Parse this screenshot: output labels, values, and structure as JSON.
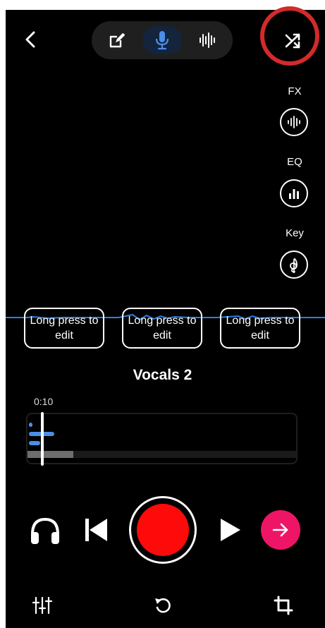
{
  "header": {
    "back_icon": "chevron-left-icon",
    "modes": [
      {
        "icon": "edit-icon",
        "active": false
      },
      {
        "icon": "microphone-icon",
        "active": true
      },
      {
        "icon": "waveform-icon",
        "active": false
      }
    ],
    "shuffle_icon": "shuffle-icon"
  },
  "side_controls": [
    {
      "label": "FX",
      "icon": "audio-wave-icon"
    },
    {
      "label": "EQ",
      "icon": "bar-chart-icon"
    },
    {
      "label": "Key",
      "icon": "treble-clef-icon"
    }
  ],
  "bubbles": [
    {
      "text": "Long press to edit"
    },
    {
      "text": "Long press to edit"
    },
    {
      "text": "Long press to edit"
    }
  ],
  "track": {
    "title": "Vocals 2",
    "time": "0:10",
    "progress_fraction": 0.17
  },
  "transport": {
    "monitor_icon": "headphones-icon",
    "skip_back_icon": "skip-back-icon",
    "record_icon": "record-icon",
    "play_icon": "play-icon",
    "next_icon": "arrow-right-icon"
  },
  "bottom_bar": {
    "mixer_icon": "mixer-icon",
    "undo_icon": "undo-icon",
    "crop_icon": "crop-icon"
  },
  "colors": {
    "background": "#000000",
    "accent_blue": "#4a8ee8",
    "record": "#ff0a0a",
    "next_button": "#ee1566",
    "highlight": "#d32a2a"
  }
}
